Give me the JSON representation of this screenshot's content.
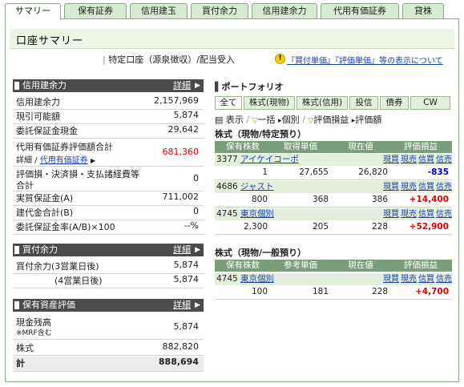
{
  "tabs": [
    "サマリー",
    "保有証券",
    "信用建玉",
    "買付余力",
    "信用建余力",
    "代用有価証券",
    "貸株"
  ],
  "page_title": "口座サマリー",
  "account_info": "特定口座（源泉徴収）/配当受入",
  "notice_link": "『買付単価』『評価単価』等の表示について",
  "detail_label": "詳細",
  "credit": {
    "title": "信用建余力",
    "rows": [
      {
        "label": "信用建余力",
        "value": "2,157,969"
      },
      {
        "label": "現引可能額",
        "value": "5,874"
      },
      {
        "label": "委託保証金現金",
        "value": "29,642"
      },
      {
        "label": "代用有価証券評価額合計",
        "value": "681,360"
      },
      {
        "label": "詳細 /",
        "value": ""
      },
      {
        "label": "評価損・決済損・支払諸経費等",
        "value": "0"
      },
      {
        "label": "合計",
        "value": ""
      },
      {
        "label": "実質保証金(A)",
        "value": "711,002"
      },
      {
        "label": "建代金合計(B)",
        "value": "0"
      },
      {
        "label": "委託保証金率(A/B)×100",
        "value": "--%"
      }
    ],
    "substitute_link": "代用有価証券"
  },
  "buying": {
    "title": "買付余力",
    "rows": [
      {
        "label": "買付余力(3営業日後)",
        "value": "5,874"
      },
      {
        "label": "(4営業日後)",
        "value": "5,874"
      }
    ]
  },
  "assets": {
    "title": "保有資産評価",
    "rows": [
      {
        "label": "現金残高",
        "value": "5,874"
      },
      {
        "label": "※MRF含む",
        "value": ""
      },
      {
        "label": "株式",
        "value": "882,820"
      },
      {
        "label": "計",
        "value": "888,694"
      }
    ]
  },
  "portfolio": {
    "title": "ポートフォリオ",
    "tabs": [
      "全て",
      "株式(現物)",
      "株式(信用)",
      "投信",
      "債券",
      "CW"
    ],
    "tools": [
      "表示",
      "一括",
      "個別",
      "評価損益",
      "評価額"
    ],
    "headers1": [
      "保有株数",
      "取得単価",
      "現在値",
      "評価損益"
    ],
    "section1": "株式（現物/特定預り）",
    "section2": "株式（現物/一般預り）",
    "headers2": [
      "保有株数",
      "参考単価",
      "現在値",
      "評価損益"
    ],
    "actions": [
      "現買",
      "現売",
      "信買",
      "信売"
    ],
    "holdings1": [
      {
        "code": "3377",
        "name": "アイケイコーポ",
        "shares": "1",
        "cost": "27,655",
        "price": "26,820",
        "pl": "-835"
      },
      {
        "code": "4686",
        "name": "ジャスト",
        "shares": "800",
        "cost": "368",
        "price": "386",
        "pl": "+14,400"
      },
      {
        "code": "4745",
        "name": "東京個別",
        "shares": "2,300",
        "cost": "205",
        "price": "228",
        "pl": "+52,900"
      }
    ],
    "holdings2": [
      {
        "code": "4745",
        "name": "東京個別",
        "shares": "100",
        "cost": "181",
        "price": "228",
        "pl": "+4,700"
      }
    ]
  }
}
